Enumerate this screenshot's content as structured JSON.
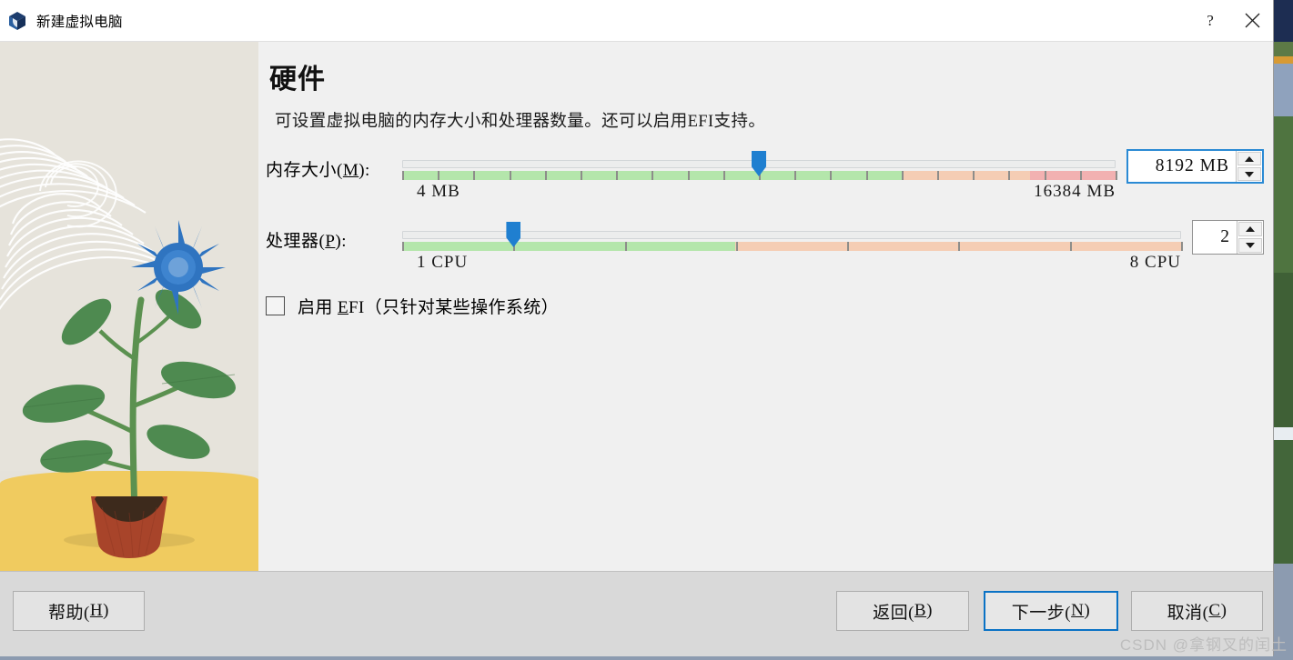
{
  "window": {
    "title": "新建虚拟电脑",
    "icon": "virtualbox-cube-icon",
    "help_button": "?",
    "close_button": "✕"
  },
  "page": {
    "heading": "硬件",
    "description": "可设置虚拟电脑的内存大小和处理器数量。还可以启用EFI支持。"
  },
  "memory": {
    "label_prefix": "内存大小(",
    "mnemonic": "M",
    "label_suffix": "):",
    "min_label": "4 MB",
    "max_label": "16384 MB",
    "value_text": "8192 MB",
    "value": 8192,
    "min": 4,
    "max": 16384,
    "handle_percent": 50,
    "green_percent": 70,
    "orange_percent": 88,
    "red_percent": 100,
    "tick_count": 20,
    "spin_up": "▲",
    "spin_down": "▼"
  },
  "cpu": {
    "label_prefix": "处理器(",
    "mnemonic": "P",
    "label_suffix": "):",
    "min_label": "1 CPU",
    "max_label": "8 CPU",
    "value_text": "2",
    "value": 2,
    "min": 1,
    "max": 8,
    "handle_percent": 14.3,
    "green_percent": 42.8,
    "orange_percent": 100,
    "tick_count": 7,
    "spin_up": "▲",
    "spin_down": "▼"
  },
  "efi": {
    "checked": false,
    "label_prefix": "启用 ",
    "mnemonic": "E",
    "label_suffix": "FI（只针对某些操作系统）"
  },
  "buttons": {
    "help": {
      "prefix": "帮助(",
      "mnemonic": "H",
      "suffix": ")"
    },
    "back": {
      "prefix": "返回(",
      "mnemonic": "B",
      "suffix": ")"
    },
    "next": {
      "prefix": "下一步(",
      "mnemonic": "N",
      "suffix": ")"
    },
    "cancel": {
      "prefix": "取消(",
      "mnemonic": "C",
      "suffix": ")"
    }
  },
  "watermark": "CSDN @拿钢叉的闰土",
  "colors": {
    "accent": "#1f7fd0",
    "default_button_border": "#0a72c5",
    "slider_green": "#b4e6ab",
    "slider_orange": "#f5cdb4",
    "slider_red": "#f2b1b1",
    "dialog_bg": "#f0f0f0",
    "footer_bg": "#d9d9d9",
    "illustration_sky": "#e6e3db",
    "illustration_ground": "#f0cb5f",
    "flower": "#2f74c0",
    "leaf": "#4e8a50",
    "pot": "#a8442a"
  }
}
